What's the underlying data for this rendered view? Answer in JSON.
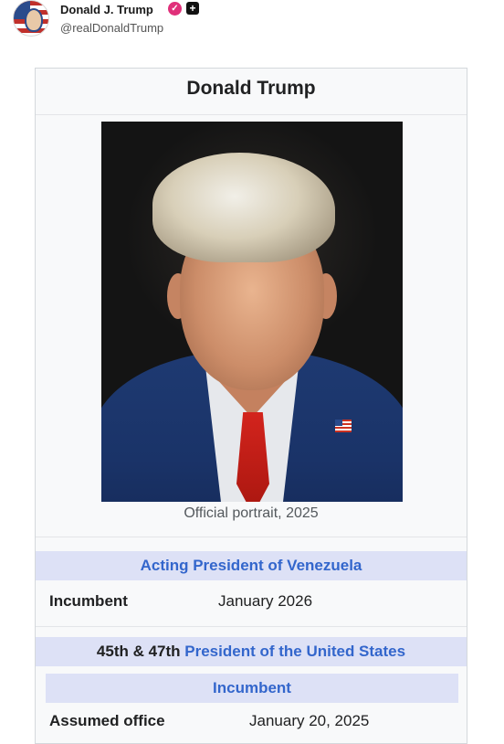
{
  "post": {
    "display_name": "Donald J. Trump",
    "handle": "@realDonaldTrump",
    "verified_icon": "verified-badge-icon",
    "plus_icon": "plus-square-icon"
  },
  "infobox": {
    "title": "Donald Trump",
    "portrait_caption": "Official portrait, 2025",
    "acting_office": "Acting President of Venezuela",
    "row1_label": "Incumbent",
    "row1_value": "January 2026",
    "office_prefix": "45th & 47th ",
    "office_link": "President of the United States",
    "incumbent_band": "Incumbent",
    "row2_label": "Assumed office",
    "row2_value": "January 20, 2025"
  },
  "colors": {
    "link": "#3366cc",
    "band": "#dde1f6",
    "infobox_bg": "#f8f9fa",
    "verified": "#e0307a"
  }
}
